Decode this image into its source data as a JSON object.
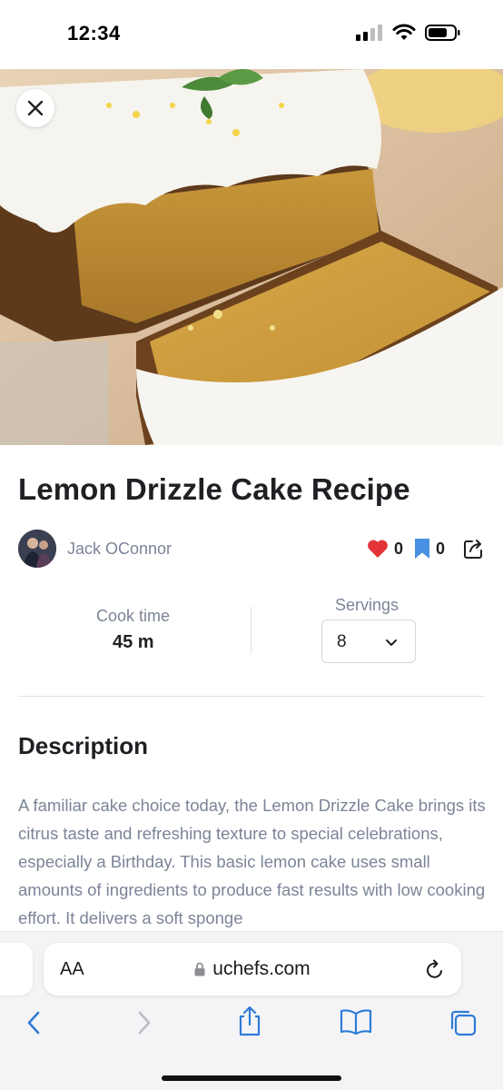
{
  "status_bar": {
    "time": "12:34"
  },
  "hero": {
    "alt": "lemon-drizzle-cake-photo"
  },
  "recipe": {
    "title": "Lemon Drizzle Cake Recipe",
    "author": "Jack OConnor",
    "likes": "0",
    "bookmarks": "0"
  },
  "meta": {
    "cook_time_label": "Cook time",
    "cook_time_value": "45 m",
    "servings_label": "Servings",
    "servings_value": "8"
  },
  "description": {
    "heading": "Description",
    "text": "A familiar cake choice today, the Lemon Drizzle Cake brings its citrus taste and refreshing texture to special celebrations, especially a Birthday. This basic lemon cake uses small amounts of ingredients to produce fast results with low cooking effort. It delivers a soft sponge"
  },
  "browser": {
    "text_size_label": "AA",
    "url": "uchefs.com"
  },
  "colors": {
    "heart": "#e3343a",
    "bookmark": "#4a90e2",
    "toolbar_blue": "#2f7bd8",
    "muted_text": "#7b8497"
  }
}
